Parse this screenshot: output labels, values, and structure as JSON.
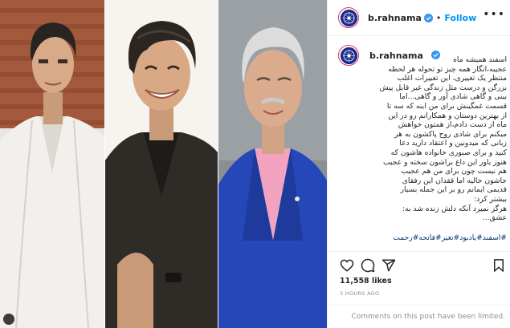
{
  "post": {
    "author": {
      "username": "b.rahnama",
      "verified": true,
      "follow_label": "Follow",
      "separator": "•"
    },
    "caption": {
      "title": "اسفند همیشه ماه",
      "lines": [
        "عجیبه،انگار همه چیز تو تحوله هر لحظه",
        "منتظر یک تغییری، این تغییرات اغلب",
        "بزرگن و درست مثل زندگی غیر قابل پیش",
        "بینی و گاهی شادی آور و گاهی...اما",
        "قسمت غمگینش برای من اینه که سه تا",
        "از بهترین دوستان و همکارانم رو در این",
        "ماه از دست دادم،از همتون خواهش",
        "میکنم برای شادی روح پاکشون به هر",
        "زبانی که میدونین و اعتقاد دارید دعا",
        "کنید و برای صبوری خانواده هاشون که",
        "هنوز باور این داغ براشون سخته و عجیب",
        "هم نیست چون برای من هم عجیب",
        "جاشون خالیه اما فقدان این رفقای",
        "قدیمی ایمانم رو بر این جمله بسیار",
        "بیشتر کرد:",
        "هرگز نمیرد آنکه دلش زنده شد به:",
        "عشق..."
      ],
      "hashtags": "#اسفند#یادبود#تغیر#فاتحه#رحمت"
    },
    "likes": "11,558 likes",
    "time": "3 HOURS AGO",
    "comments_limited": "Comments on this post have been limited.",
    "more_icon": "more-horizontal-icon",
    "icons": [
      "heart-icon",
      "comment-icon",
      "share-icon",
      "bookmark-icon"
    ],
    "colors": {
      "follow": "#0095f6",
      "hashtag": "#00376b",
      "verified": "#3897f0",
      "muted": "#8e8e8e",
      "story_ring": "#e1306c",
      "avatar_bg": "#1b2c8a"
    }
  }
}
